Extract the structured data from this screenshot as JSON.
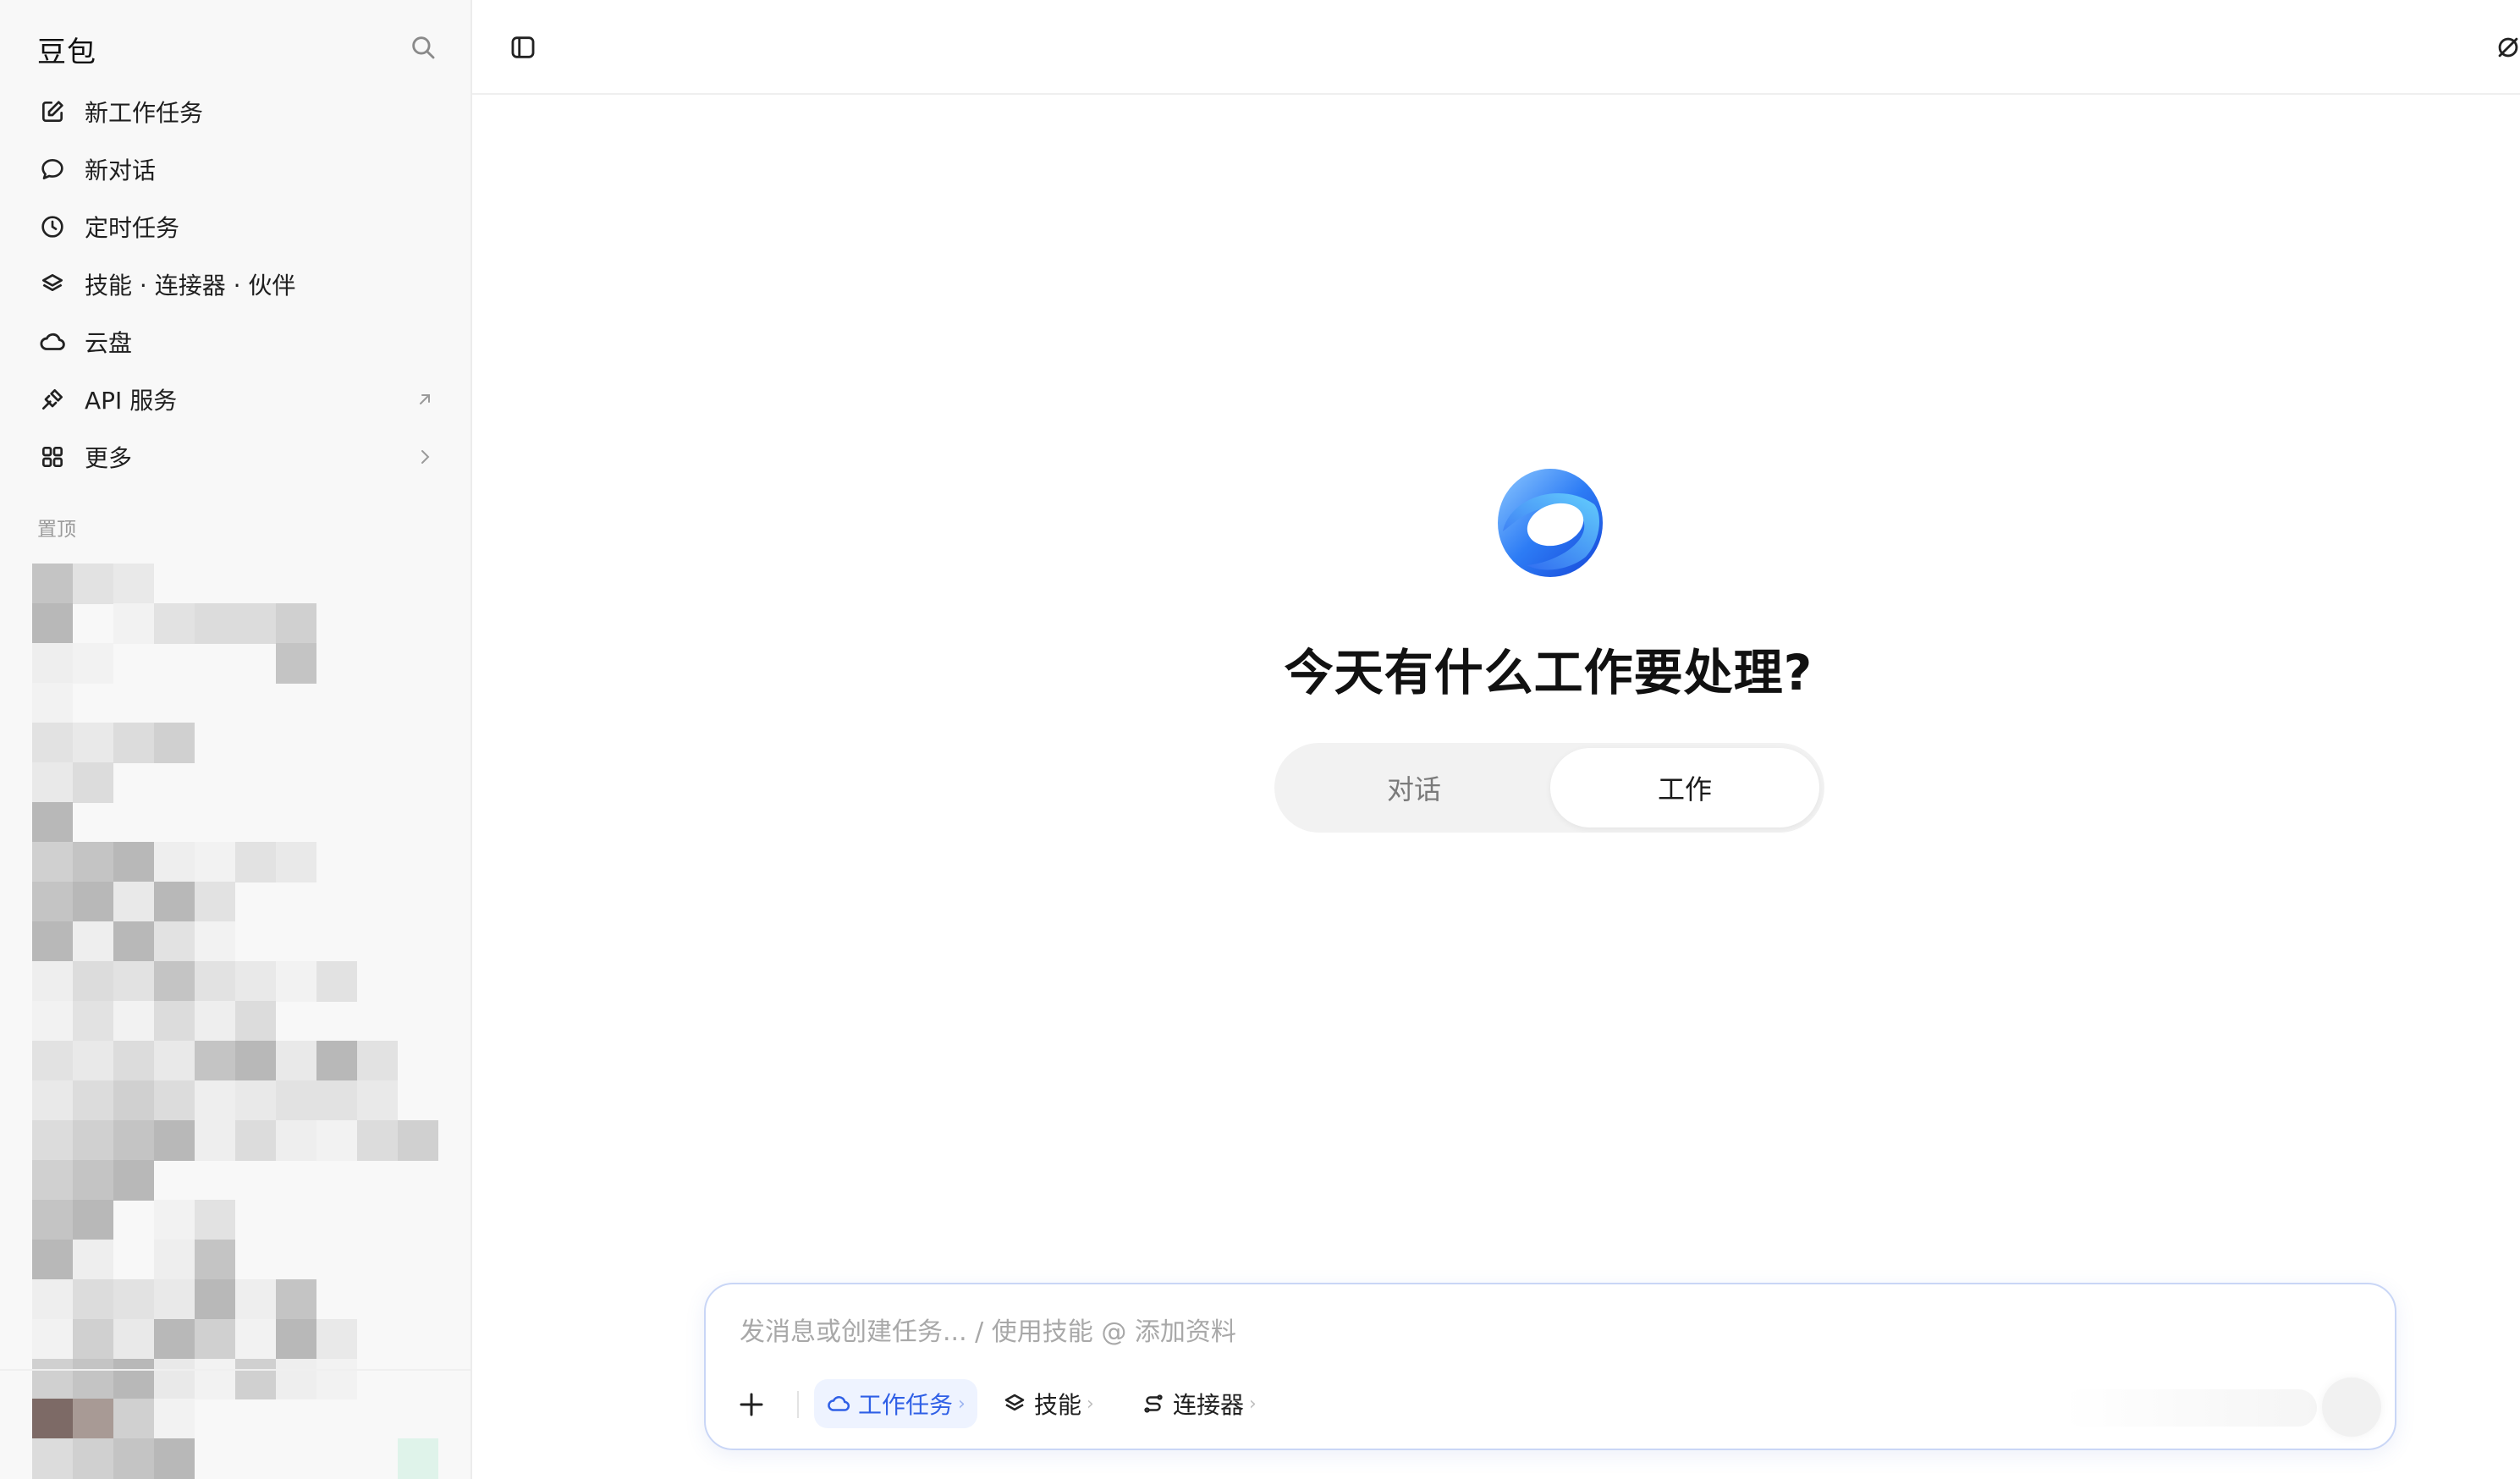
{
  "sidebar": {
    "brand": "豆包",
    "items": [
      {
        "label": "新工作任务",
        "icon": "edit-icon"
      },
      {
        "label": "新对话",
        "icon": "chat-bubble-icon"
      },
      {
        "label": "定时任务",
        "icon": "clock-icon"
      },
      {
        "label": "技能 · 连接器 · 伙伴",
        "icon": "layers-icon"
      },
      {
        "label": "云盘",
        "icon": "cloud-icon"
      },
      {
        "label": "API 服务",
        "icon": "plug-icon",
        "trail_icon": "external-arrow-icon"
      },
      {
        "label": "更多",
        "icon": "grid-icon",
        "trail_icon": "chevron-right-icon"
      }
    ],
    "pinned_label": "置顶"
  },
  "main": {
    "headline": "今天有什么工作要处理?",
    "mode_tabs": [
      {
        "label": "对话",
        "selected": false
      },
      {
        "label": "工作",
        "selected": true
      }
    ]
  },
  "composer": {
    "placeholder": "发消息或创建任务... / 使用技能 @ 添加资料",
    "value": "",
    "chips": [
      {
        "label": "工作任务",
        "icon": "cloud-icon",
        "active": true
      },
      {
        "label": "技能",
        "icon": "layers-icon",
        "active": false
      },
      {
        "label": "连接器",
        "icon": "connector-icon",
        "active": false
      }
    ],
    "chevron": "›"
  },
  "colors": {
    "accent": "#2f5fe6",
    "sidebar_bg": "#f8f8f8",
    "composer_border": "#c9d6f6"
  }
}
